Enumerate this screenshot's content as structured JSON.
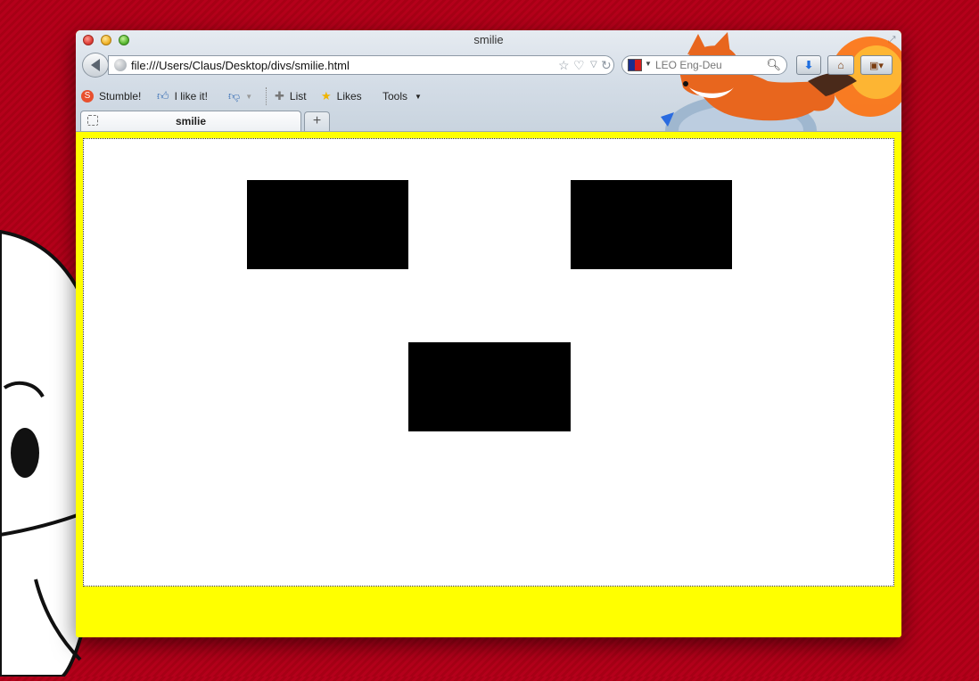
{
  "window": {
    "title": "smilie"
  },
  "navbar": {
    "url": "file:///Users/Claus/Desktop/divs/smilie.html",
    "search_placeholder": "LEO Eng-Deu"
  },
  "bookmarks": {
    "items": [
      {
        "label": "Stumble!"
      },
      {
        "label": "I like it!"
      },
      {
        "label": "List"
      },
      {
        "label": "Likes"
      },
      {
        "label": "Tools"
      }
    ]
  },
  "tabs": [
    {
      "label": "smilie",
      "active": true
    }
  ],
  "page": {
    "background_color": "#ffff00",
    "content_background": "#ffffff",
    "block_color": "#000000"
  },
  "colors": {
    "desktop": "#b5001b",
    "fox": "#e8661e"
  }
}
